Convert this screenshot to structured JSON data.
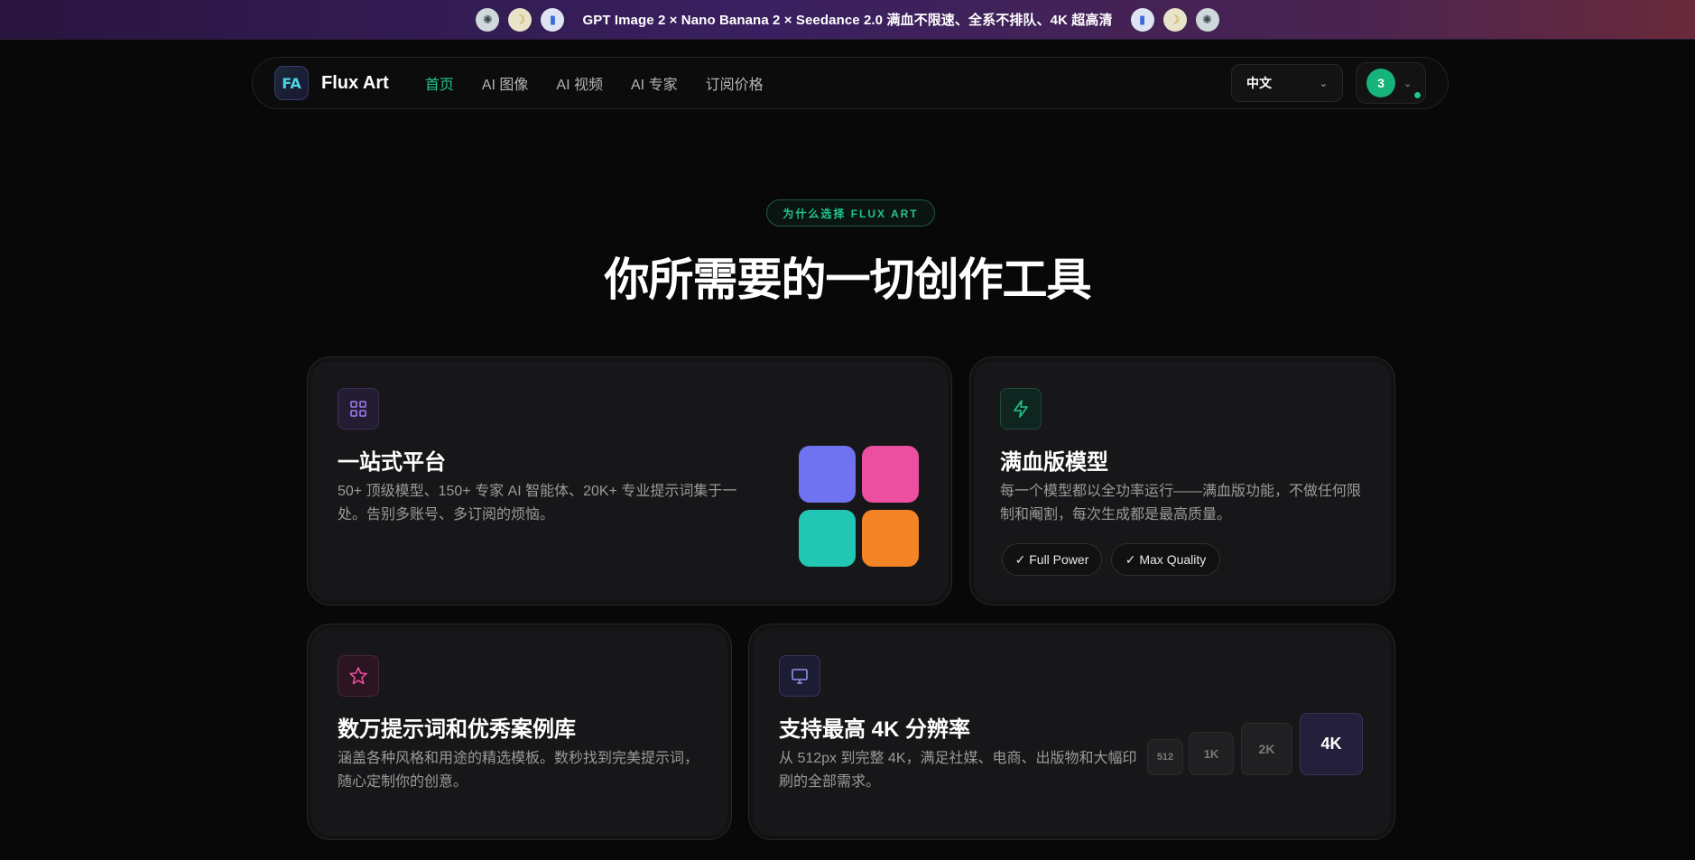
{
  "banner": {
    "text": "GPT Image 2 × Nano Banana 2 × Seedance 2.0 满血不限速、全系不排队、4K 超高清"
  },
  "nav": {
    "brand": "Flux Art",
    "logo_mark": "FA",
    "links": [
      {
        "label": "首页",
        "active": true
      },
      {
        "label": "AI 图像",
        "active": false
      },
      {
        "label": "AI 视频",
        "active": false
      },
      {
        "label": "AI 专家",
        "active": false
      },
      {
        "label": "订阅价格",
        "active": false
      }
    ],
    "language": "中文",
    "user_badge": "3"
  },
  "hero": {
    "eyebrow": "为什么选择 FLUX ART",
    "headline": "你所需要的一切创作工具"
  },
  "features": [
    {
      "title": "一站式平台",
      "description": "50+ 顶级模型、150+ 专家 AI 智能体、20K+ 专业提示词集于一处。告别多账号、多订阅的烦恼。",
      "icon": "grid-icon"
    },
    {
      "title": "满血版模型",
      "description": "每一个模型都以全功率运行——满血版功能，不做任何限制和阉割，每次生成都是最高质量。",
      "icon": "lightning-icon",
      "chips": [
        "✓ Full Power",
        "✓ Max Quality"
      ]
    },
    {
      "title": "数万提示词和优秀案例库",
      "description": "涵盖各种风格和用途的精选模板。数秒找到完美提示词，随心定制你的创意。",
      "icon": "star-icon"
    },
    {
      "title": "支持最高 4K 分辨率",
      "description": "从 512px 到完整 4K，满足社媒、电商、出版物和大幅印刷的全部需求。",
      "icon": "monitor-icon",
      "resolutions": [
        "512",
        "1K",
        "2K",
        "4K"
      ]
    }
  ],
  "colors": {
    "accent": "#22c58b",
    "swatches": [
      "#7073f0",
      "#ec4f9f",
      "#22c7b4",
      "#f58426"
    ]
  }
}
